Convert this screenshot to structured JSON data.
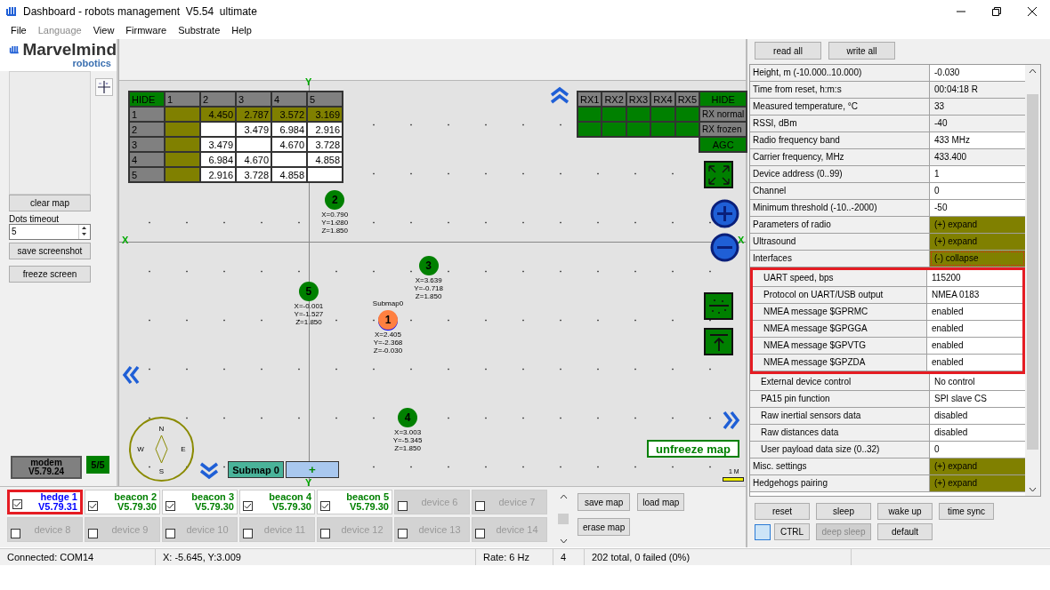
{
  "window": {
    "title": "Dashboard - robots management  V5.54  ultimate"
  },
  "menu": [
    {
      "label": "File",
      "disabled": false
    },
    {
      "label": "Language",
      "disabled": true
    },
    {
      "label": "View",
      "disabled": false
    },
    {
      "label": "Firmware",
      "disabled": false
    },
    {
      "label": "Substrate",
      "disabled": false
    },
    {
      "label": "Help",
      "disabled": false
    }
  ],
  "logo": {
    "name": "Marvelmind",
    "sub": "robotics"
  },
  "left_panel": {
    "clear_button": "clear map",
    "dots_timeout": {
      "label": "Dots timeout",
      "value": "5"
    },
    "buttons": [
      "save screenshot",
      "freeze screen"
    ]
  },
  "modem": {
    "name": "modem",
    "version": "V5.79.24",
    "count": "5/5"
  },
  "distance_table": {
    "hide": "HIDE",
    "columns": [
      "1",
      "2",
      "3",
      "4",
      "5"
    ],
    "rows": [
      {
        "label": "1",
        "cells": [
          {
            "highlighted": true
          },
          {
            "value": "4.450",
            "highlighted": true
          },
          {
            "value": "2.787",
            "highlighted": true
          },
          {
            "value": "3.572",
            "highlighted": true
          },
          {
            "value": "3.169",
            "highlighted": true
          }
        ]
      },
      {
        "label": "2",
        "cells": [
          {
            "highlighted": true
          },
          {
            "highlighted": false
          },
          {
            "value": "3.479",
            "highlighted": false
          },
          {
            "value": "6.984",
            "highlighted": false
          },
          {
            "value": "2.916",
            "highlighted": false
          }
        ]
      },
      {
        "label": "3",
        "cells": [
          {
            "highlighted": true
          },
          {
            "value": "3.479",
            "highlighted": false
          },
          {
            "highlighted": false
          },
          {
            "value": "4.670",
            "highlighted": false
          },
          {
            "value": "3.728",
            "highlighted": false
          }
        ]
      },
      {
        "label": "4",
        "cells": [
          {
            "highlighted": true
          },
          {
            "value": "6.984",
            "highlighted": false
          },
          {
            "value": "4.670",
            "highlighted": false
          },
          {
            "highlighted": false
          },
          {
            "value": "4.858",
            "highlighted": false
          }
        ]
      },
      {
        "label": "5",
        "cells": [
          {
            "highlighted": true
          },
          {
            "value": "2.916",
            "highlighted": false
          },
          {
            "value": "3.728",
            "highlighted": false
          },
          {
            "value": "4.858",
            "highlighted": false
          },
          {
            "highlighted": false
          }
        ]
      }
    ]
  },
  "rx_table": {
    "columns": [
      "RX1",
      "RX2",
      "RX3",
      "RX4",
      "RX5"
    ],
    "hide": "HIDE",
    "rows": [
      "RX normal",
      "RX frozen"
    ],
    "agc": "AGC"
  },
  "map": {
    "x_axis_labels": [
      "X",
      "X"
    ],
    "y_axis_labels": [
      "Y",
      "Y"
    ],
    "nodes": [
      {
        "label": "2",
        "kind": "beacon",
        "coords": [
          "X=0.790",
          "Y=1.280",
          "Z=1.850"
        ]
      },
      {
        "label": "3",
        "kind": "beacon",
        "coords": [
          "X=3.639",
          "Y=-0.718",
          "Z=1.850"
        ]
      },
      {
        "label": "5",
        "kind": "beacon",
        "coords": [
          "X=-0.001",
          "Y=-1.527",
          "Z=1.850"
        ]
      },
      {
        "label": "1",
        "kind": "hedge",
        "submap": "Submap0",
        "coords": [
          "X=2.405",
          "Y=-2.368",
          "Z=-0.030"
        ]
      },
      {
        "label": "4",
        "kind": "beacon",
        "coords": [
          "X=3.003",
          "Y=-5.345",
          "Z=1.850"
        ]
      }
    ],
    "compass": {
      "north": "N",
      "west": "W",
      "east": "E",
      "south": "S"
    },
    "submap_button": "Submap 0",
    "add_button": "+",
    "unfreeze_button": "unfreeze map",
    "scale": "1 M"
  },
  "devices": [
    {
      "name": "hedge 1",
      "version": "V5.79.31",
      "online": true,
      "checked": true,
      "color": "#0000ff",
      "highlighted": true
    },
    {
      "name": "beacon 2",
      "version": "V5.79.30",
      "online": true,
      "checked": true,
      "color": "#008000",
      "highlighted": false
    },
    {
      "name": "beacon 3",
      "version": "V5.79.30",
      "online": true,
      "checked": true,
      "color": "#008000",
      "highlighted": false
    },
    {
      "name": "beacon 4",
      "version": "V5.79.30",
      "online": true,
      "checked": true,
      "color": "#008000",
      "highlighted": false
    },
    {
      "name": "beacon 5",
      "version": "V5.79.30",
      "online": true,
      "checked": true,
      "color": "#008000",
      "highlighted": false
    },
    {
      "name": "device 6",
      "online": false,
      "checked": false,
      "highlighted": false
    },
    {
      "name": "device 7",
      "online": false,
      "checked": false,
      "highlighted": false
    },
    {
      "name": "device 8",
      "online": false,
      "checked": false,
      "highlighted": false
    },
    {
      "name": "device 9",
      "online": false,
      "checked": false,
      "highlighted": false
    },
    {
      "name": "device 10",
      "online": false,
      "checked": false,
      "highlighted": false
    },
    {
      "name": "device 11",
      "online": false,
      "checked": false,
      "highlighted": false
    },
    {
      "name": "device 12",
      "online": false,
      "checked": false,
      "highlighted": false
    },
    {
      "name": "device 13",
      "online": false,
      "checked": false,
      "highlighted": false
    },
    {
      "name": "device 14",
      "online": false,
      "checked": false,
      "highlighted": false
    }
  ],
  "map_buttons": {
    "save": "save map",
    "load": "load map",
    "erase": "erase map"
  },
  "settings": {
    "top_buttons": [
      "read all",
      "write all"
    ],
    "rows": [
      {
        "label": "Height, m (-10.000..10.000)",
        "value": "-0.030",
        "kind": "value"
      },
      {
        "label": "Time from reset, h:m:s",
        "value": "00:04:18   R",
        "kind": "readonly"
      },
      {
        "label": "Measured temperature, °C",
        "value": "33",
        "kind": "readonly"
      },
      {
        "label": "RSSI, dBm",
        "value": "-40",
        "kind": "readonly"
      },
      {
        "label": "Radio frequency band",
        "value": "433 MHz",
        "kind": "value"
      },
      {
        "label": "Carrier frequency, MHz",
        "value": "433.400",
        "kind": "readonly"
      },
      {
        "label": "Device address (0..99)",
        "value": "1",
        "kind": "value"
      },
      {
        "label": "Channel",
        "value": "0",
        "kind": "value"
      },
      {
        "label": "Minimum threshold (-10..-2000)",
        "value": "-50",
        "kind": "value"
      },
      {
        "label": "Parameters of radio",
        "value": "(+) expand",
        "kind": "section",
        "expanded": false
      },
      {
        "label": "Ultrasound",
        "value": "(+) expand",
        "kind": "section",
        "expanded": false
      },
      {
        "label": "Interfaces",
        "value": "(-) collapse",
        "kind": "section",
        "expanded": true,
        "children": [
          {
            "highlighted": true,
            "rows": [
              {
                "label": "UART speed, bps",
                "value": "115200",
                "kind": "value"
              },
              {
                "label": "Protocol on UART/USB output",
                "value": "NMEA 0183",
                "kind": "value"
              },
              {
                "label": "NMEA message $GPRMC",
                "value": "enabled",
                "kind": "value"
              },
              {
                "label": "NMEA message $GPGGA",
                "value": "enabled",
                "kind": "value"
              },
              {
                "label": "NMEA message $GPVTG",
                "value": "enabled",
                "kind": "value"
              },
              {
                "label": "NMEA message $GPZDA",
                "value": "enabled",
                "kind": "value"
              }
            ]
          },
          {
            "highlighted": false,
            "rows": [
              {
                "label": "External device control",
                "value": "No control",
                "kind": "value"
              },
              {
                "label": "PA15 pin function",
                "value": "SPI slave CS",
                "kind": "value"
              },
              {
                "label": "Raw inertial sensors data",
                "value": "disabled",
                "kind": "value"
              },
              {
                "label": "Raw distances data",
                "value": "disabled",
                "kind": "value"
              },
              {
                "label": "User payload data size (0..32)",
                "value": "0",
                "kind": "value"
              }
            ]
          }
        ]
      },
      {
        "label": "Misc. settings",
        "value": "(+) expand",
        "kind": "section",
        "expanded": false
      },
      {
        "label": "Hedgehogs pairing",
        "value": "(+) expand",
        "kind": "section",
        "expanded": false
      }
    ],
    "bottom_buttons": [
      {
        "label": "reset",
        "disabled": false
      },
      {
        "label": "sleep",
        "disabled": false
      },
      {
        "label": "wake up",
        "disabled": false
      },
      {
        "label": "time sync",
        "disabled": false
      },
      {
        "label": "CTRL",
        "disabled": false
      },
      {
        "label": "deep sleep",
        "disabled": true
      },
      {
        "label": "default",
        "disabled": false
      }
    ],
    "indicator": {
      "checked": false
    }
  },
  "status_bar": [
    "Connected: COM14",
    "X: -5.645, Y:3.009",
    "Rate: 6 Hz",
    "4",
    "202 total, 0 failed (0%)"
  ]
}
